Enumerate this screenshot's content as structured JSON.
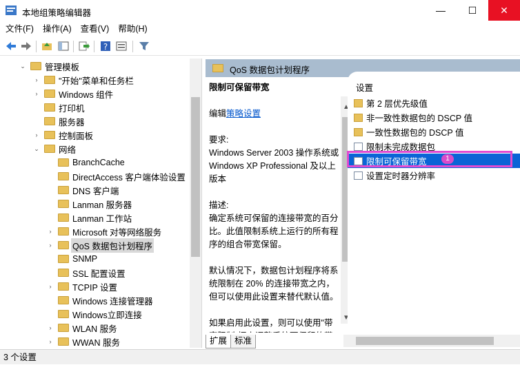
{
  "window": {
    "title": "本地组策略编辑器",
    "minimize": "—",
    "maximize": "☐",
    "close": "✕"
  },
  "menu": [
    "文件(F)",
    "操作(A)",
    "查看(V)",
    "帮助(H)"
  ],
  "toolbar_icons": [
    "back-arrow-icon",
    "forward-arrow-icon",
    "up-folder-icon",
    "show-tree-icon",
    "export-icon",
    "help-icon",
    "properties-icon",
    "filter-icon"
  ],
  "tree": [
    {
      "label": "管理模板",
      "exp": "⌄",
      "level": 2
    },
    {
      "label": "\"开始\"菜单和任务栏",
      "exp": "›",
      "level": 3
    },
    {
      "label": "Windows 组件",
      "exp": "›",
      "level": 3
    },
    {
      "label": "打印机",
      "exp": "",
      "level": 3
    },
    {
      "label": "服务器",
      "exp": "",
      "level": 3
    },
    {
      "label": "控制面板",
      "exp": "›",
      "level": 3
    },
    {
      "label": "网络",
      "exp": "⌄",
      "level": 3
    },
    {
      "label": "BranchCache",
      "exp": "",
      "level": 4
    },
    {
      "label": "DirectAccess 客户端体验设置",
      "exp": "",
      "level": 4
    },
    {
      "label": "DNS 客户端",
      "exp": "",
      "level": 4
    },
    {
      "label": "Lanman 服务器",
      "exp": "",
      "level": 4
    },
    {
      "label": "Lanman 工作站",
      "exp": "",
      "level": 4
    },
    {
      "label": "Microsoft 对等网络服务",
      "exp": "›",
      "level": 4
    },
    {
      "label": "QoS 数据包计划程序",
      "exp": "›",
      "level": 4,
      "selected": true
    },
    {
      "label": "SNMP",
      "exp": "",
      "level": 4
    },
    {
      "label": "SSL 配置设置",
      "exp": "",
      "level": 4
    },
    {
      "label": "TCPIP 设置",
      "exp": "›",
      "level": 4
    },
    {
      "label": "Windows 连接管理器",
      "exp": "",
      "level": 4
    },
    {
      "label": "Windows立即连接",
      "exp": "",
      "level": 4
    },
    {
      "label": "WLAN 服务",
      "exp": "›",
      "level": 4
    },
    {
      "label": "WWAN 服务",
      "exp": "›",
      "level": 4
    }
  ],
  "right_header": "QoS 数据包计划程序",
  "description": {
    "title": "限制可保留带宽",
    "edit_prefix": "编辑",
    "edit_link": "策略设置",
    "requirements_label": "要求:",
    "requirements": "Windows Server 2003 操作系统或 Windows XP Professional 及以上版本",
    "desc_label": "描述:",
    "desc": "确定系统可保留的连接带宽的百分比。此值限制系统上运行的所有程序的组合带宽保留。",
    "default_text": "默认情况下，数据包计划程序将系统限制在 20% 的连接带宽之内，但可以使用此设置来替代默认值。",
    "enabled_text": "如果启用此设置，则可以使用\"带宽限制\"框来调整系统可保留的带宽数量。"
  },
  "list": {
    "header": "设置",
    "items": [
      {
        "label": "第 2 层优先级值",
        "type": "folder"
      },
      {
        "label": "非一致性数据包的 DSCP 值",
        "type": "folder"
      },
      {
        "label": "一致性数据包的 DSCP 值",
        "type": "folder"
      },
      {
        "label": "限制未完成数据包",
        "type": "policy"
      },
      {
        "label": "限制可保留带宽",
        "type": "policy",
        "selected": true
      },
      {
        "label": "设置定时器分辨率",
        "type": "policy"
      }
    ],
    "badge": "1"
  },
  "tabs": [
    "扩展",
    "标准"
  ],
  "status": "3 个设置",
  "colors": {
    "highlight_box": "#e14bd1",
    "selection": "#0a64d6",
    "close": "#e81123",
    "header": "#a9bccf"
  }
}
